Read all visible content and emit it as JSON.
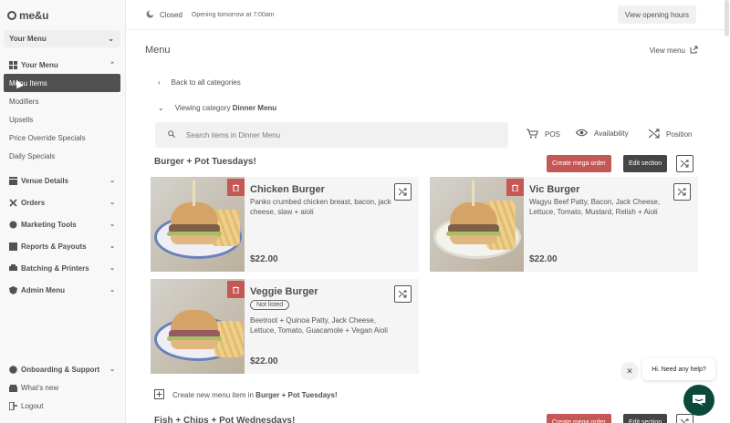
{
  "brand": {
    "logo_text": "me&u"
  },
  "sidebar": {
    "menu_select": "Your Menu",
    "your_menu_label": "Your Menu",
    "sub_items": [
      "Menu Items",
      "Modifiers",
      "Upsells",
      "Price Override Specials",
      "Daily Specials"
    ],
    "groups": [
      "Venue Details",
      "Orders",
      "Marketing Tools",
      "Reports & Payouts",
      "Batching & Printers",
      "Admin Menu"
    ],
    "bottom": [
      "Onboarding & Support",
      "What's new",
      "Logout"
    ]
  },
  "topbar": {
    "status": "Closed",
    "status_sub": "Opening tomorrow at 7:00am",
    "hours_button": "View opening hours"
  },
  "main": {
    "title": "Menu",
    "view_menu": "View menu",
    "back": "Back to all categories",
    "viewing_prefix": "Viewing category",
    "viewing_category": "Dinner Menu",
    "search_placeholder": "Search items in Dinner Menu",
    "tools": {
      "pos": "POS",
      "availability": "Availability",
      "position": "Position"
    }
  },
  "sections": [
    {
      "title": "Burger + Pot Tuesdays!",
      "create_mega": "Create mega order",
      "edit_section": "Edit section",
      "create_item_prefix": "Create new menu item in",
      "create_item_target": "Burger + Pot Tuesdays!",
      "items": [
        {
          "name": "Chicken Burger",
          "badge": "",
          "description": "Panko crumbed chicken breast, bacon, jack cheese, slaw + aioli",
          "price": "$22.00"
        },
        {
          "name": "Vic Burger",
          "badge": "",
          "description": "Wagyu Beef Patty, Bacon, Jack Cheese, Lettuce, Tomato, Mustard, Relish + Aioli",
          "price": "$22.00"
        },
        {
          "name": "Veggie Burger",
          "badge": "Not listed",
          "description": "Beetroot + Quinoa Patty, Jack Cheese, Lettuce, Tomato, Guacamole + Vegan Aioli",
          "price": "$22.00"
        }
      ]
    },
    {
      "title": "Fish + Chips + Pot Wednesdays!",
      "create_mega": "Create mega order",
      "edit_section": "Edit section"
    }
  ],
  "chat": {
    "greeting": "Hi. Need any help?"
  },
  "colors": {
    "accent_red": "#b52a24",
    "chat_green": "#0b4a3b",
    "active_nav": "#1f1f1f"
  }
}
